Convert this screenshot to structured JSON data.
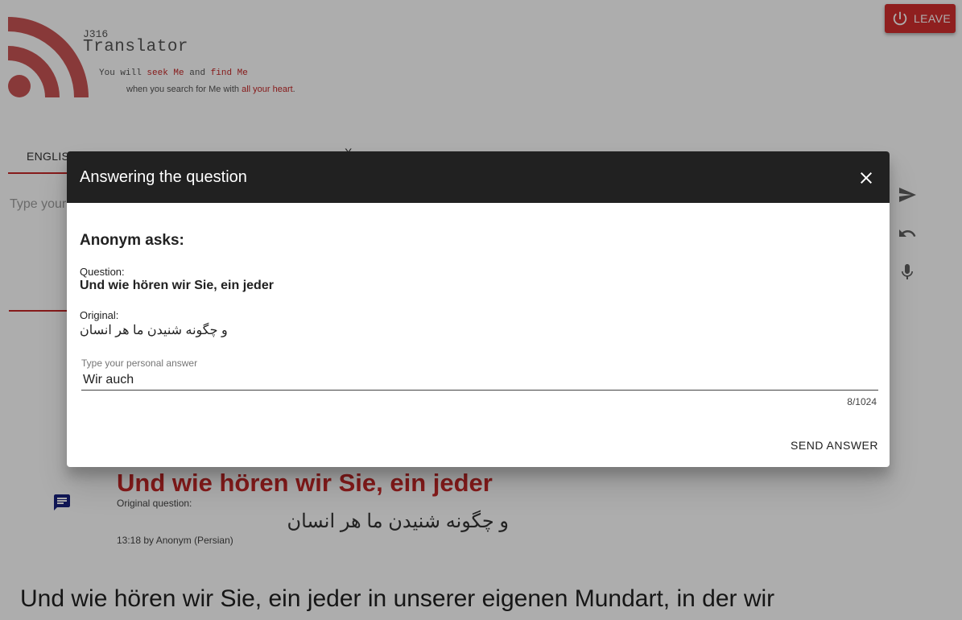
{
  "header": {
    "code": "J316",
    "title": "Translator",
    "tagline_1": {
      "before": "You will ",
      "seek": "seek Me",
      "mid": " and ",
      "find": "find Me"
    },
    "tagline_2": {
      "before": "when you search for Me with ",
      "highlight": "all your heart",
      "after": "."
    },
    "leave_label": "LEAVE",
    "leave_icon": "power-icon"
  },
  "tabs": {
    "first_label": "ENGLIS",
    "second_fragment": "X"
  },
  "composer": {
    "placeholder": "Type your"
  },
  "side_actions": [
    "send-icon",
    "undo-icon",
    "mic-icon"
  ],
  "question_card": {
    "title": "Und wie hören wir Sie, ein jeder",
    "original_label": "Original question:",
    "original_text": "و چگونه شنیدن ما هر انسان",
    "meta": "13:18 by Anonym (Persian)"
  },
  "transcript_line": "Und wie hören wir Sie, ein jeder in unserer eigenen Mundart, in der wir",
  "dialog": {
    "title": "Answering the question",
    "asker": "Anonym asks:",
    "question_label": "Question:",
    "question_text": "Und wie hören wir Sie, ein jeder",
    "original_label": "Original:",
    "original_text": "و چگونه شنیدن ما هر انسان",
    "answer_label": "Type your personal answer",
    "answer_value": "Wir auch",
    "char_count": "8/1024",
    "send_label": "SEND ANSWER"
  },
  "colors": {
    "accent": "#c62828",
    "leave_button": "#d32f2f",
    "dialog_header": "#212121",
    "chat_icon": "#1a237e"
  }
}
